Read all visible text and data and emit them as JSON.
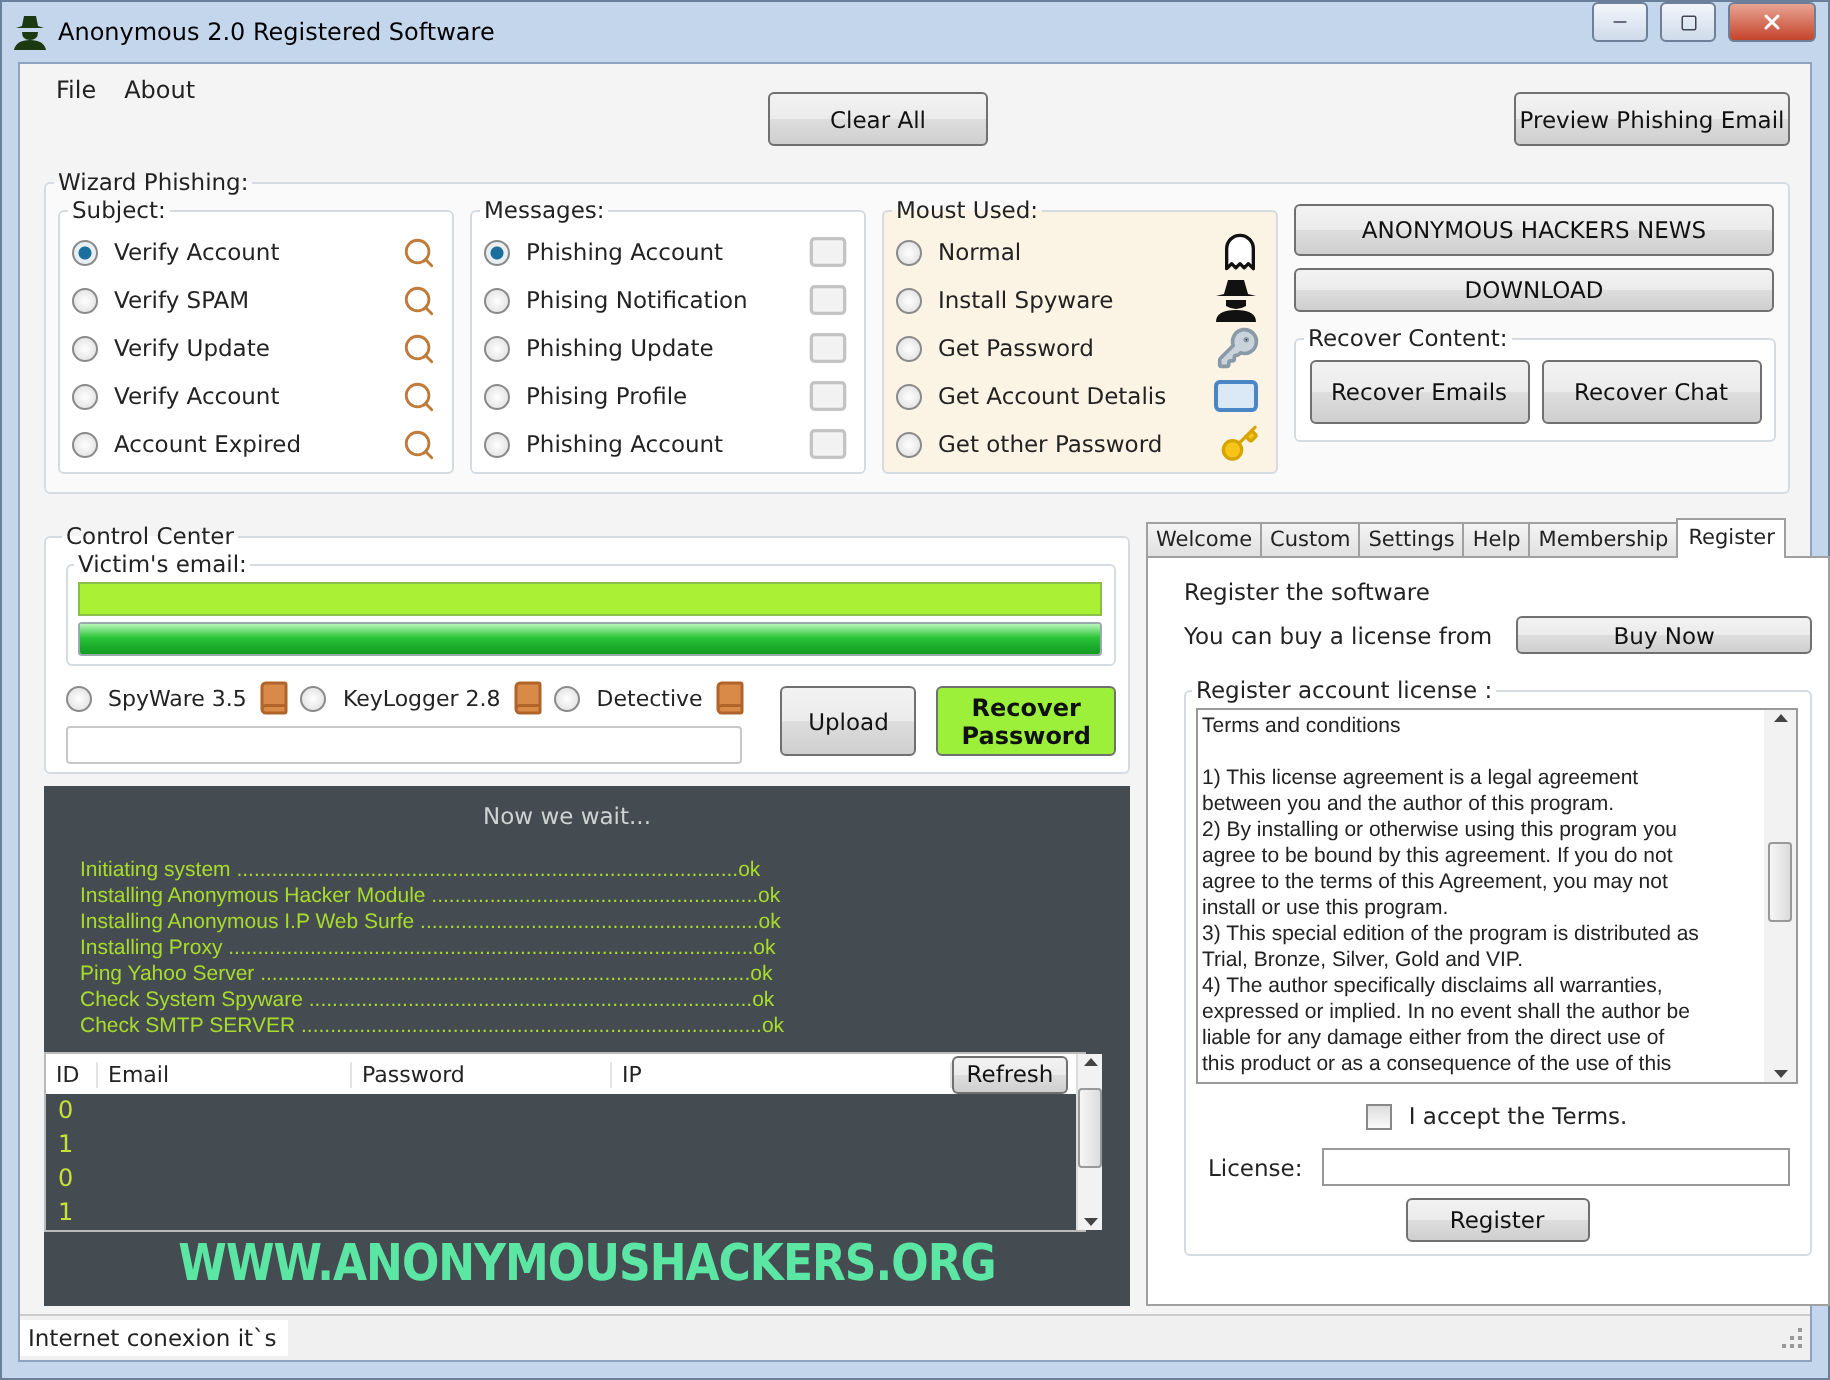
{
  "window": {
    "title": "Anonymous 2.0 Registered Software"
  },
  "menu": [
    "File",
    "About"
  ],
  "toolbar": {
    "clear_button": "Clear All",
    "preview_button": "Preview Phishing Email"
  },
  "wizard": {
    "title": "Wizard Phishing:",
    "groups": [
      {
        "kind": "subject",
        "title": "Subject:",
        "options": [
          {
            "label": "Verify Account",
            "selected": true
          },
          {
            "label": "Verify SPAM",
            "selected": false
          },
          {
            "label": "Verify Update",
            "selected": false
          },
          {
            "label": "Verify Account",
            "selected": false
          },
          {
            "label": "Account Expired",
            "selected": false
          }
        ]
      },
      {
        "kind": "messages",
        "title": "Messages:",
        "options": [
          {
            "label": "Phishing Account",
            "selected": true
          },
          {
            "label": "Phising Notification",
            "selected": false
          },
          {
            "label": "Phishing Update",
            "selected": false
          },
          {
            "label": "Phising Profile",
            "selected": false
          },
          {
            "label": "Phishing Account",
            "selected": false
          }
        ]
      },
      {
        "kind": "mode",
        "title": "Moust Used:",
        "options": [
          {
            "label": "Normal",
            "selected": false
          },
          {
            "label": "Install Spyware",
            "selected": false
          },
          {
            "label": "Get Password",
            "selected": false
          },
          {
            "label": "Get Account Detalis",
            "selected": false
          },
          {
            "label": "Get other Password",
            "selected": false
          }
        ]
      }
    ],
    "news_button": "ANONYMOUS HACKERS NEWS",
    "download_button": "DOWNLOAD",
    "recover": {
      "title": "Recover Content:",
      "buttons": [
        "Recover Emails",
        "Recover Chat"
      ]
    }
  },
  "control_center": {
    "title": "Control Center",
    "email_title": "Victim's email:",
    "level": 1,
    "tools": [
      {
        "label": "SpyWare 3.5",
        "selected": false
      },
      {
        "label": "KeyLogger 2.8",
        "selected": false
      },
      {
        "label": "Detective",
        "selected": false
      }
    ],
    "upload_button": "Upload",
    "recover_button": "Recover Password"
  },
  "console": {
    "heading": "Now we wait...",
    "log": [
      "Initiating system ......................................................................................ok",
      "Installing Anonymous Hacker Module ........................................................ok",
      "Installing Anonymous I.P Web Surfe ..........................................................ok",
      "Installing Proxy ..........................................................................................ok",
      "Ping Yahoo Server ....................................................................................ok",
      "Check System Spyware ............................................................................ok",
      "Check SMTP SERVER ...............................................................................ok"
    ],
    "table": {
      "columns": [
        "ID",
        "Email",
        "Password",
        "IP"
      ],
      "refresh_button": "Refresh",
      "rows": [
        "0",
        "1",
        "0",
        "1"
      ]
    },
    "banner": "WWW.ANONYMOUSHACKERS.ORG"
  },
  "tabs": [
    {
      "label": "Welcome",
      "selected": false
    },
    {
      "label": "Custom",
      "selected": false
    },
    {
      "label": "Settings",
      "selected": false
    },
    {
      "label": "Help",
      "selected": false
    },
    {
      "label": "Membership",
      "selected": false
    },
    {
      "label": "Register",
      "selected": true
    }
  ],
  "register": {
    "intro": "Register the software",
    "buy_text": "You can buy a license from",
    "buy_button": "Buy Now",
    "group_title": "Register account license :",
    "terms_heading": "Terms and conditions",
    "terms": [
      "1) This license agreement is a legal agreement",
      "between you and the author of this program.",
      "2) By installing or otherwise using this program you",
      "agree to be bound by this agreement. If you do not",
      "agree to the terms of this Agreement, you may not",
      "install or use this program.",
      "3) This special edition of the program is distributed as",
      "Trial, Bronze, Silver, Gold and VIP.",
      "4) The author specifically disclaims all warranties,",
      "expressed or implied. In no event shall the author be",
      "liable for any damage either from the direct use of",
      "this product or as a consequence of the use of this"
    ],
    "accept": {
      "label": "I accept the Terms.",
      "checked": false
    },
    "license_label": "License:",
    "register_button": "Register"
  },
  "status_bar": "Internet conexion it`s"
}
